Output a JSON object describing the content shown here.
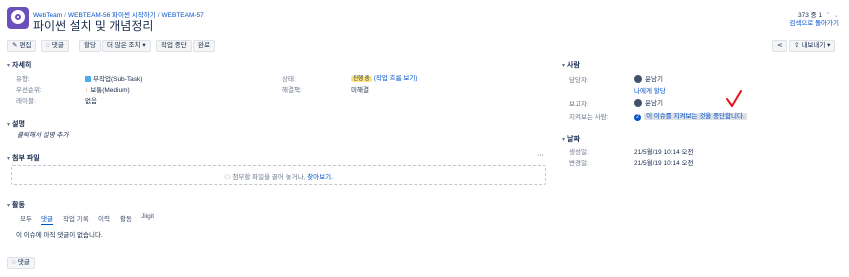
{
  "header": {
    "breadcrumbs": [
      "WebTeam",
      "WEBTEAM-56 파이썬 시작하기",
      "WEBTEAM-57"
    ],
    "title": "파이썬 설치 및 개념정리",
    "pager": "373 중 1",
    "back_to_search": "검색으로 돌아가기"
  },
  "toolbar": {
    "edit": "편집",
    "comment": "댓글",
    "assign": "할당",
    "more": "더 많은 조치",
    "stop_progress": "작업 중단",
    "done": "완료",
    "export": "내보내기"
  },
  "details": {
    "heading": "자세히",
    "type_label": "유형:",
    "type_value": "부작업(Sub-Task)",
    "priority_label": "우선순위:",
    "priority_value": "보통(Medium)",
    "labels_label": "레이블:",
    "labels_value": "없음",
    "status_label": "상태:",
    "status_badge": "진행 중",
    "status_link": "(작업 흐름 보기)",
    "resolution_label": "해결책:",
    "resolution_value": "미해결"
  },
  "description": {
    "heading": "설명",
    "placeholder": "클릭해서 설명 추가"
  },
  "attachments": {
    "heading": "첨부 파일",
    "more": "⋯",
    "drop_text": "첨부할 파일을 끌어 놓거나,",
    "browse": "찾아보기."
  },
  "activity": {
    "heading": "활동",
    "tabs": [
      "모두",
      "댓글",
      "작업 기록",
      "이력",
      "활동",
      "Jiigit"
    ],
    "active_tab": 1,
    "empty": "이 이슈에 아직 댓글이 없습니다.",
    "comment_button": "댓글"
  },
  "people": {
    "heading": "사람",
    "assignee_label": "담당자:",
    "assignee": "윤남기",
    "assign_to_me": "나에게 할당",
    "reporter_label": "보고자:",
    "reporter": "윤남기",
    "watchers_label": "지켜보는 사람:",
    "watchers_count": "2",
    "watch_text": "이 이슈를 지켜보는 것을 중단합니다."
  },
  "dates": {
    "heading": "날짜",
    "created_label": "생성일:",
    "created": "21/5월/19 10:14 오전",
    "updated_label": "변경일:",
    "updated": "21/5월/19 10:14 오전"
  },
  "colors": {
    "link": "#0052cc",
    "status": "#ffe380",
    "annotation": "#e8101a"
  }
}
